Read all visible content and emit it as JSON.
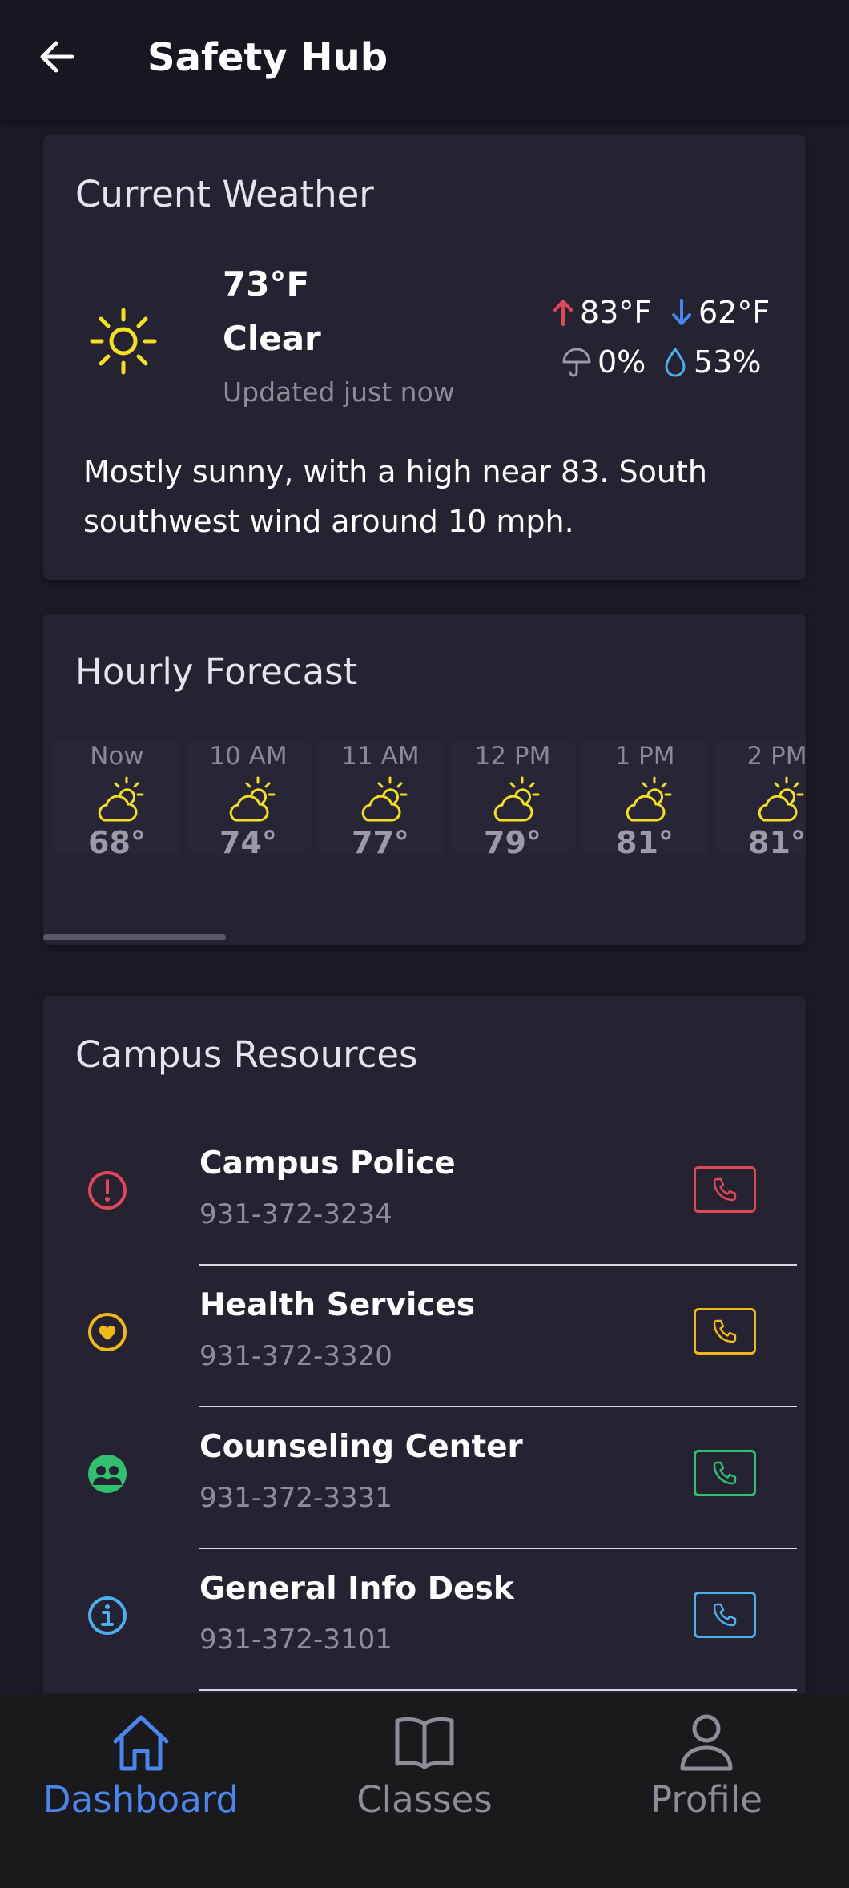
{
  "header": {
    "title": "Safety Hub",
    "back_icon": "arrow-left-icon"
  },
  "weather": {
    "title": "Current Weather",
    "icon": "sun-icon",
    "temperature": "73°F",
    "condition": "Clear",
    "updated": "Updated just now",
    "high": "83°F",
    "low": "62°F",
    "precipitation": "0%",
    "humidity": "53%",
    "description": "Mostly sunny, with a high near 83. South southwest wind around 10 mph.",
    "colors": {
      "sun": "#f5e020",
      "high": "#e04858",
      "low": "#4a86f0",
      "humidity": "#4ab0f0"
    }
  },
  "hourly": {
    "title": "Hourly Forecast",
    "icon": "partly-cloudy-icon",
    "hours": [
      {
        "label": "Now",
        "temp": "68°"
      },
      {
        "label": "10 AM",
        "temp": "74°"
      },
      {
        "label": "11 AM",
        "temp": "77°"
      },
      {
        "label": "12 PM",
        "temp": "79°"
      },
      {
        "label": "1 PM",
        "temp": "81°"
      },
      {
        "label": "2 PM",
        "temp": "81°"
      }
    ]
  },
  "resources": {
    "title": "Campus Resources",
    "items": [
      {
        "name": "Campus Police",
        "phone": "931-372-3234",
        "icon": "alert-circle-icon",
        "color": "#e04858"
      },
      {
        "name": "Health Services",
        "phone": "931-372-3320",
        "icon": "heart-circle-icon",
        "color": "#f0b818"
      },
      {
        "name": "Counseling Center",
        "phone": "931-372-3331",
        "icon": "people-circle-icon",
        "color": "#30c070"
      },
      {
        "name": "General Info Desk",
        "phone": "931-372-3101",
        "icon": "info-circle-icon",
        "color": "#4ab0f0"
      }
    ]
  },
  "nav": {
    "items": [
      {
        "label": "Dashboard",
        "icon": "home-icon",
        "active": true
      },
      {
        "label": "Classes",
        "icon": "book-icon",
        "active": false
      },
      {
        "label": "Profile",
        "icon": "person-icon",
        "active": false
      }
    ],
    "active_color": "#4a86f0",
    "inactive_color": "#8e8c99"
  }
}
